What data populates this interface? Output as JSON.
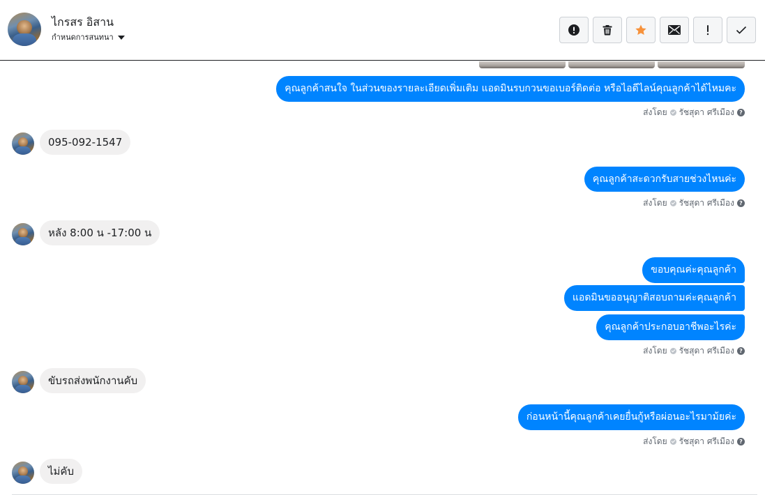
{
  "header": {
    "contact_name": "ไกรสร อิสาน",
    "conversation_setting_label": "กำหนดการสนทนา"
  },
  "toolbar": {
    "buttons": [
      {
        "name": "report-spam",
        "icon": "alert-circle-icon"
      },
      {
        "name": "delete",
        "icon": "trash-icon"
      },
      {
        "name": "star",
        "icon": "star-icon",
        "color": "#f7923b"
      },
      {
        "name": "mark-unread",
        "icon": "envelope-icon"
      },
      {
        "name": "follow-up",
        "icon": "exclamation-icon"
      },
      {
        "name": "mark-done",
        "icon": "check-icon"
      }
    ]
  },
  "messages": {
    "out_1": "คุณลูกค้าสนใจ ในส่วนของรายละเอียดเพิ่มเติม แอดมินรบกวนขอเบอร์ติดต่อ หรือไอดีไลน์คุณลูกค้าได้ไหมคะ",
    "in_1": "095-092-1547",
    "out_2": "คุณลูกค้าสะดวกรับสายช่วงไหนค่ะ",
    "in_2": "หลัง 8:00 น -17:00 น",
    "out_3a": "ขอบคุณค่ะคุณลูกค้า",
    "out_3b": "แอดมินขออนุญาติสอบถามค่ะคุณลูกค้า",
    "out_3c": "คุณลูกค้าประกอบอาชีพอะไรค่ะ",
    "in_3": "ขับรถส่งพนักงานคับ",
    "out_4": "ก่อนหน้านี้คุณลูกค้าเคยยื่นกู้หรือผ่อนอะไรมาม้ยค่ะ",
    "in_4": "ไม่คับ"
  },
  "sent_by": {
    "prefix": "ส่งโดย",
    "agent": "รัชสุดา ศรีเมือง",
    "help": "?"
  },
  "colors": {
    "outgoing_bubble": "#0084ff",
    "incoming_bubble": "#f1f0f0",
    "accent_star": "#f7923b"
  }
}
